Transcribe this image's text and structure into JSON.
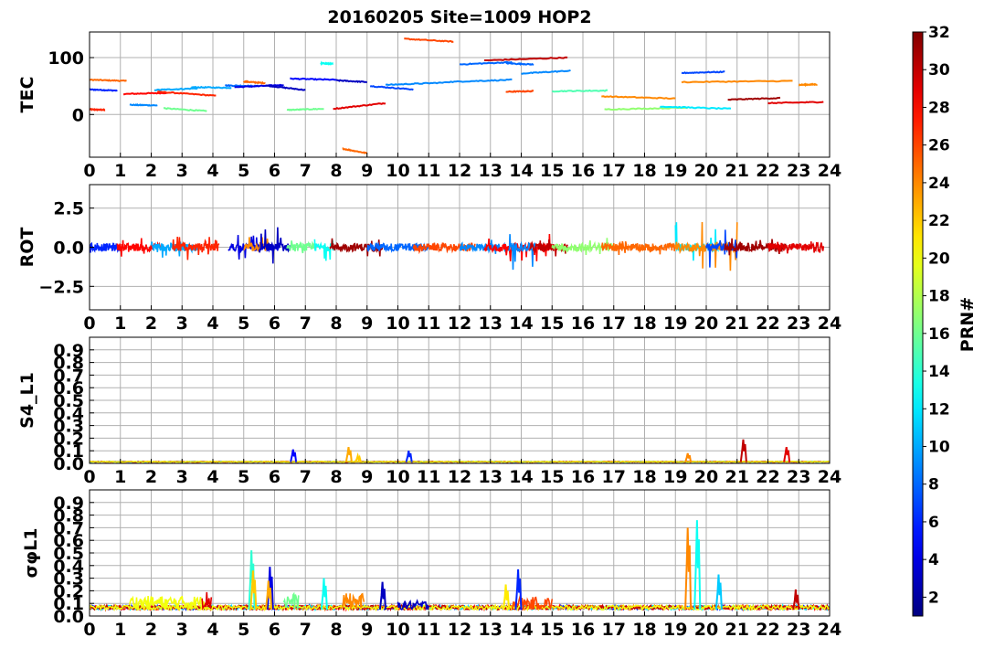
{
  "figure": {
    "title": "20160205 Site=1009 HOP2",
    "colorbar": {
      "label": "PRN#",
      "range": [
        1,
        32
      ],
      "ticks": [
        2,
        4,
        6,
        8,
        10,
        12,
        14,
        16,
        18,
        20,
        22,
        24,
        26,
        28,
        30,
        32
      ],
      "colormap": "jet"
    }
  },
  "chart_data": [
    {
      "type": "line",
      "ylabel": "TEC",
      "xlim": [
        0,
        24
      ],
      "ylim": [
        -75,
        145
      ],
      "xticks": [
        0,
        1,
        2,
        3,
        4,
        5,
        6,
        7,
        8,
        9,
        10,
        11,
        12,
        13,
        14,
        15,
        16,
        17,
        18,
        19,
        20,
        21,
        22,
        23,
        24
      ],
      "yticks": [
        {
          "v": 0,
          "label": "0"
        },
        {
          "v": 100,
          "label": "100"
        }
      ],
      "grid": true,
      "series": [
        {
          "prn": 27,
          "x": [
            0.0,
            0.5
          ],
          "y": [
            9,
            8
          ]
        },
        {
          "prn": 6,
          "x": [
            0.0,
            0.9
          ],
          "y": [
            44,
            42
          ]
        },
        {
          "prn": 25,
          "x": [
            0.0,
            1.2
          ],
          "y": [
            61,
            59
          ]
        },
        {
          "prn": 28,
          "x": [
            1.1,
            2.5
          ],
          "y": [
            36,
            38
          ]
        },
        {
          "prn": 9,
          "x": [
            1.3,
            2.2
          ],
          "y": [
            17,
            16
          ]
        },
        {
          "prn": 27,
          "x": [
            2.2,
            4.1
          ],
          "y": [
            40,
            33
          ]
        },
        {
          "prn": 10,
          "x": [
            2.1,
            3.5
          ],
          "y": [
            43,
            46
          ]
        },
        {
          "prn": 16,
          "x": [
            2.4,
            3.8
          ],
          "y": [
            11,
            6
          ]
        },
        {
          "prn": 10,
          "x": [
            3.3,
            4.6
          ],
          "y": [
            48,
            47
          ]
        },
        {
          "prn": 8,
          "x": [
            4.4,
            5.5
          ],
          "y": [
            51,
            50
          ]
        },
        {
          "prn": 4,
          "x": [
            4.7,
            6.3
          ],
          "y": [
            48,
            52
          ]
        },
        {
          "prn": 25,
          "x": [
            5.0,
            5.7
          ],
          "y": [
            58,
            55
          ]
        },
        {
          "prn": 3,
          "x": [
            5.7,
            7.0
          ],
          "y": [
            51,
            43
          ]
        },
        {
          "prn": 16,
          "x": [
            6.4,
            7.6
          ],
          "y": [
            8,
            10
          ]
        },
        {
          "prn": 5,
          "x": [
            6.5,
            8.0
          ],
          "y": [
            63,
            61
          ]
        },
        {
          "prn": 3,
          "x": [
            8.0,
            9.0
          ],
          "y": [
            60,
            57
          ]
        },
        {
          "prn": 13,
          "x": [
            7.5,
            7.9
          ],
          "y": [
            90,
            89
          ]
        },
        {
          "prn": 25,
          "x": [
            8.2,
            9.0
          ],
          "y": [
            -60,
            -68
          ]
        },
        {
          "prn": 29,
          "x": [
            7.9,
            9.6
          ],
          "y": [
            10,
            20
          ]
        },
        {
          "prn": 7,
          "x": [
            9.1,
            10.5
          ],
          "y": [
            50,
            44
          ]
        },
        {
          "prn": 9,
          "x": [
            9.6,
            11.5
          ],
          "y": [
            52,
            56
          ]
        },
        {
          "prn": 9,
          "x": [
            11.5,
            13.7
          ],
          "y": [
            57,
            61
          ]
        },
        {
          "prn": 26,
          "x": [
            10.2,
            11.8
          ],
          "y": [
            133,
            128
          ]
        },
        {
          "prn": 8,
          "x": [
            12.0,
            13.7
          ],
          "y": [
            88,
            92
          ]
        },
        {
          "prn": 30,
          "x": [
            12.8,
            15.5
          ],
          "y": [
            95,
            100
          ]
        },
        {
          "prn": 8,
          "x": [
            13.5,
            14.4
          ],
          "y": [
            90,
            88
          ]
        },
        {
          "prn": 9,
          "x": [
            14.0,
            15.6
          ],
          "y": [
            72,
            77
          ]
        },
        {
          "prn": 26,
          "x": [
            13.5,
            14.4
          ],
          "y": [
            40,
            41
          ]
        },
        {
          "prn": 15,
          "x": [
            15.0,
            16.8
          ],
          "y": [
            41,
            42
          ]
        },
        {
          "prn": 24,
          "x": [
            16.6,
            19.0
          ],
          "y": [
            32,
            28
          ]
        },
        {
          "prn": 17,
          "x": [
            16.7,
            19.4
          ],
          "y": [
            9,
            12
          ]
        },
        {
          "prn": 12,
          "x": [
            18.5,
            20.8
          ],
          "y": [
            14,
            10
          ]
        },
        {
          "prn": 7,
          "x": [
            19.2,
            20.6
          ],
          "y": [
            73,
            75
          ]
        },
        {
          "prn": 24,
          "x": [
            19.2,
            22.8
          ],
          "y": [
            57,
            59
          ]
        },
        {
          "prn": 31,
          "x": [
            20.7,
            22.4
          ],
          "y": [
            26,
            29
          ]
        },
        {
          "prn": 29,
          "x": [
            22.0,
            23.8
          ],
          "y": [
            20,
            22
          ]
        },
        {
          "prn": 24,
          "x": [
            23.0,
            23.6
          ],
          "y": [
            52,
            53
          ]
        }
      ]
    },
    {
      "type": "line",
      "ylabel": "ROT",
      "xlim": [
        0,
        24
      ],
      "ylim": [
        -4,
        4
      ],
      "xticks": [
        0,
        1,
        2,
        3,
        4,
        5,
        6,
        7,
        8,
        9,
        10,
        11,
        12,
        13,
        14,
        15,
        16,
        17,
        18,
        19,
        20,
        21,
        22,
        23,
        24
      ],
      "yticks": [
        {
          "v": -2.5,
          "label": "−2.5"
        },
        {
          "v": 0,
          "label": "0.0"
        },
        {
          "v": 2.5,
          "label": "2.5"
        }
      ],
      "grid": true,
      "series": [
        {
          "prn": 6,
          "x": [
            0.0,
            1.0
          ],
          "amp": 0.35
        },
        {
          "prn": 28,
          "x": [
            0.9,
            2.3
          ],
          "amp": 0.6
        },
        {
          "prn": 10,
          "x": [
            2.0,
            3.5
          ],
          "amp": 0.7
        },
        {
          "prn": 27,
          "x": [
            2.7,
            4.2
          ],
          "amp": 0.9
        },
        {
          "prn": 4,
          "x": [
            4.5,
            6.2
          ],
          "amp": 0.8
        },
        {
          "prn": 24,
          "x": [
            5.0,
            5.8
          ],
          "amp": 0.9
        },
        {
          "prn": 3,
          "x": [
            5.5,
            6.5
          ],
          "amp": 1.4
        },
        {
          "prn": 16,
          "x": [
            6.4,
            7.3
          ],
          "amp": 0.5
        },
        {
          "prn": 13,
          "x": [
            7.3,
            7.9
          ],
          "amp": 0.9
        },
        {
          "prn": 31,
          "x": [
            7.8,
            9.5
          ],
          "amp": 0.6
        },
        {
          "prn": 8,
          "x": [
            9.0,
            11.0
          ],
          "amp": 0.35
        },
        {
          "prn": 26,
          "x": [
            10.5,
            12.5
          ],
          "amp": 0.3
        },
        {
          "prn": 9,
          "x": [
            12.0,
            13.5
          ],
          "amp": 0.5
        },
        {
          "prn": 28,
          "x": [
            12.8,
            15.0
          ],
          "amp": 0.9
        },
        {
          "prn": 9,
          "x": [
            13.6,
            14.5
          ],
          "amp": 2.2
        },
        {
          "prn": 30,
          "x": [
            14.3,
            15.5
          ],
          "amp": 0.6
        },
        {
          "prn": 17,
          "x": [
            15.0,
            17.0
          ],
          "amp": 0.6
        },
        {
          "prn": 25,
          "x": [
            16.6,
            19.0
          ],
          "amp": 0.5
        },
        {
          "prn": 12,
          "x": [
            19.0,
            20.4
          ],
          "amp": 1.6
        },
        {
          "prn": 24,
          "x": [
            19.0,
            21.0
          ],
          "amp": 1.8
        },
        {
          "prn": 7,
          "x": [
            20.0,
            21.0
          ],
          "amp": 1.3
        },
        {
          "prn": 31,
          "x": [
            20.6,
            22.6
          ],
          "amp": 0.7
        },
        {
          "prn": 29,
          "x": [
            22.0,
            23.8
          ],
          "amp": 0.4
        }
      ]
    },
    {
      "type": "line",
      "ylabel": "S4_L1",
      "xlim": [
        0,
        24
      ],
      "ylim": [
        0,
        1
      ],
      "xticks": [
        0,
        1,
        2,
        3,
        4,
        5,
        6,
        7,
        8,
        9,
        10,
        11,
        12,
        13,
        14,
        15,
        16,
        17,
        18,
        19,
        20,
        21,
        22,
        23,
        24
      ],
      "yticks": [
        {
          "v": 0,
          "label": "0.0"
        },
        {
          "v": 0.1,
          "label": "0.1"
        },
        {
          "v": 0.2,
          "label": "0.2"
        },
        {
          "v": 0.3,
          "label": "0.3"
        },
        {
          "v": 0.4,
          "label": "0.4"
        },
        {
          "v": 0.5,
          "label": "0.5"
        },
        {
          "v": 0.6,
          "label": "0.6"
        },
        {
          "v": 0.7,
          "label": "0.7"
        },
        {
          "v": 0.8,
          "label": "0.8"
        },
        {
          "v": 0.9,
          "label": "0.9"
        }
      ],
      "grid": true,
      "baseline": 0.01,
      "spikes": [
        {
          "prn": 5,
          "x": 6.6,
          "y": 0.11
        },
        {
          "prn": 23,
          "x": 8.4,
          "y": 0.13
        },
        {
          "prn": 22,
          "x": 8.7,
          "y": 0.06
        },
        {
          "prn": 6,
          "x": 10.35,
          "y": 0.1
        },
        {
          "prn": 24,
          "x": 19.4,
          "y": 0.08
        },
        {
          "prn": 30,
          "x": 21.2,
          "y": 0.19
        },
        {
          "prn": 29,
          "x": 22.6,
          "y": 0.13
        }
      ]
    },
    {
      "type": "line",
      "ylabel": "σφL1",
      "xlim": [
        0,
        24
      ],
      "ylim": [
        0,
        1
      ],
      "xticks": [
        0,
        1,
        2,
        3,
        4,
        5,
        6,
        7,
        8,
        9,
        10,
        11,
        12,
        13,
        14,
        15,
        16,
        17,
        18,
        19,
        20,
        21,
        22,
        23,
        24
      ],
      "yticks": [
        {
          "v": 0,
          "label": "0.0"
        },
        {
          "v": 0.1,
          "label": "0.1"
        },
        {
          "v": 0.2,
          "label": "0.2"
        },
        {
          "v": 0.3,
          "label": "0.3"
        },
        {
          "v": 0.4,
          "label": "0.4"
        },
        {
          "v": 0.5,
          "label": "0.5"
        },
        {
          "v": 0.6,
          "label": "0.6"
        },
        {
          "v": 0.7,
          "label": "0.7"
        },
        {
          "v": 0.8,
          "label": "0.8"
        },
        {
          "v": 0.9,
          "label": "0.9"
        }
      ],
      "grid": true,
      "baseline": 0.05,
      "spikes": [
        {
          "prn": 14,
          "x": 5.25,
          "y": 0.52
        },
        {
          "prn": 22,
          "x": 5.3,
          "y": 0.36
        },
        {
          "prn": 4,
          "x": 5.85,
          "y": 0.39
        },
        {
          "prn": 23,
          "x": 5.8,
          "y": 0.28
        },
        {
          "prn": 13,
          "x": 7.6,
          "y": 0.3
        },
        {
          "prn": 3,
          "x": 9.5,
          "y": 0.27
        },
        {
          "prn": 21,
          "x": 13.5,
          "y": 0.25
        },
        {
          "prn": 6,
          "x": 13.9,
          "y": 0.37
        },
        {
          "prn": 24,
          "x": 19.4,
          "y": 0.7
        },
        {
          "prn": 13,
          "x": 19.7,
          "y": 0.76
        },
        {
          "prn": 11,
          "x": 20.4,
          "y": 0.33
        },
        {
          "prn": 30,
          "x": 22.9,
          "y": 0.21
        }
      ],
      "bumps": [
        {
          "prn": 20,
          "x": [
            1.3,
            3.8
          ],
          "y": 0.16
        },
        {
          "prn": 29,
          "x": 3.8,
          "y": 0.2
        },
        {
          "prn": 16,
          "x": [
            6.3,
            6.8
          ],
          "y": 0.18
        },
        {
          "prn": 24,
          "x": [
            8.2,
            8.9
          ],
          "y": 0.18
        },
        {
          "prn": 3,
          "x": [
            10.0,
            11.0
          ],
          "y": 0.12
        },
        {
          "prn": 26,
          "x": [
            13.7,
            15.0
          ],
          "y": 0.15
        }
      ]
    }
  ]
}
